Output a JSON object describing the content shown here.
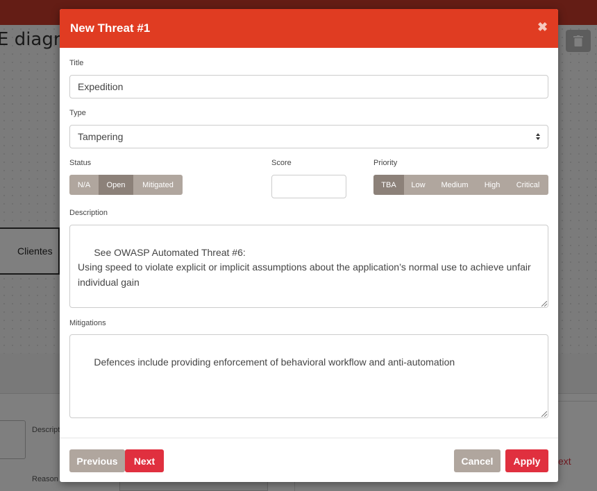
{
  "background": {
    "title_fragment": "E diagra",
    "node_label": "Clientes",
    "desc_label_fragment": "Descript",
    "reason_label_fragment": "Reason l",
    "text_fragment": "ext"
  },
  "modal": {
    "title": "New Threat #1",
    "close_icon": "close-icon",
    "fields": {
      "title": {
        "label": "Title",
        "value": "Expedition"
      },
      "type": {
        "label": "Type",
        "value": "Tampering"
      },
      "status": {
        "label": "Status",
        "options": [
          "N/A",
          "Open",
          "Mitigated"
        ],
        "selected": "Open"
      },
      "score": {
        "label": "Score",
        "value": ""
      },
      "priority": {
        "label": "Priority",
        "options": [
          "TBA",
          "Low",
          "Medium",
          "High",
          "Critical"
        ],
        "selected": "TBA"
      },
      "description": {
        "label": "Description",
        "value": "See OWASP Automated Threat #6:\nUsing speed to violate explicit or implicit assumptions about the application’s normal use to achieve unfair individual gain"
      },
      "mitigations": {
        "label": "Mitigations",
        "value": "Defences include providing enforcement of behavioral workflow and anti-automation"
      }
    },
    "footer": {
      "previous": "Previous",
      "next": "Next",
      "cancel": "Cancel",
      "apply": "Apply"
    }
  },
  "colors": {
    "header": "#e03c22",
    "primary_button": "#e0303f",
    "secondary_button": "#b0a69e",
    "active_toggle": "#8c8179"
  }
}
